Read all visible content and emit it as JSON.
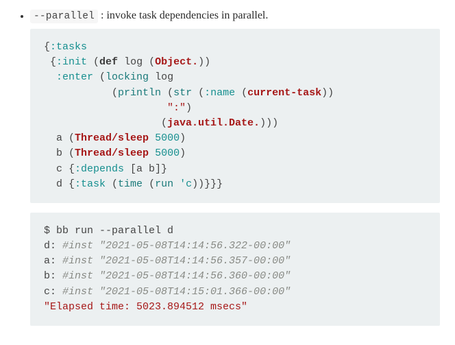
{
  "bullet": {
    "flag": "--parallel",
    "desc": " : invoke task dependencies in parallel."
  },
  "code1": {
    "l1a": "{",
    "l1b": ":tasks",
    "l2a": " {",
    "l2b": ":init",
    "l2c": " (",
    "l2d": "def",
    "l2e": " log (",
    "l2f": "Object.",
    "l2g": "))",
    "l3a": "  ",
    "l3b": ":enter",
    "l3c": " (",
    "l3d": "locking",
    "l3e": " log",
    "l4a": "           (",
    "l4b": "println",
    "l4c": " (",
    "l4d": "str",
    "l4e": " (",
    "l4f": ":name",
    "l4g": " (",
    "l4h": "current-task",
    "l4i": "))",
    "l5a": "                    ",
    "l5b": "\":\"",
    "l5c": ")",
    "l6a": "                   (",
    "l6b": "java.util.Date.",
    "l6c": ")))",
    "l7a": "  a (",
    "l7b": "Thread/sleep",
    "l7c": " ",
    "l7d": "5000",
    "l7e": ")",
    "l8a": "  b (",
    "l8b": "Thread/sleep",
    "l8c": " ",
    "l8d": "5000",
    "l8e": ")",
    "l9a": "  c {",
    "l9b": ":depends",
    "l9c": " [a b]}",
    "l10a": "  d {",
    "l10b": ":task",
    "l10c": " (",
    "l10d": "time",
    "l10e": " (",
    "l10f": "run",
    "l10g": " ",
    "l10h": "'c",
    "l10i": "))}}}"
  },
  "code2": {
    "l1": "$ bb run --parallel d",
    "l2a": "d: ",
    "l2b": "#inst \"2021-05-08T14:14:56.322-00:00\"",
    "l3a": "a: ",
    "l3b": "#inst \"2021-05-08T14:14:56.357-00:00\"",
    "l4a": "b: ",
    "l4b": "#inst \"2021-05-08T14:14:56.360-00:00\"",
    "l5a": "c: ",
    "l5b": "#inst \"2021-05-08T14:15:01.366-00:00\"",
    "l6": "\"Elapsed time: 5023.894512 msecs\""
  }
}
